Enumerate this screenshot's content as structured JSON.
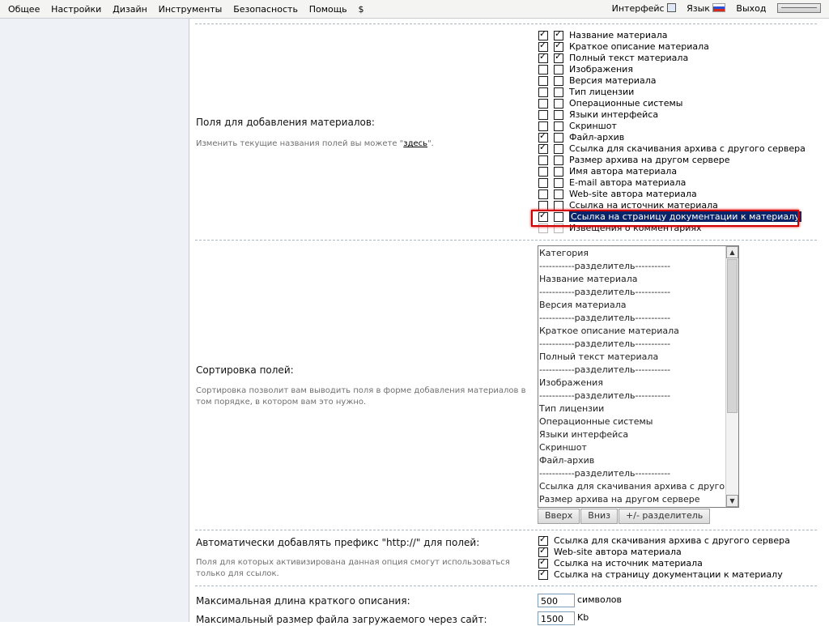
{
  "topbar": {
    "menu": [
      "Общее",
      "Настройки",
      "Дизайн",
      "Инструменты",
      "Безопасность",
      "Помощь",
      "$"
    ],
    "interface_label": "Интерфейс",
    "language_label": "Язык",
    "exit_label": "Выход"
  },
  "fields_section": {
    "label": "Поля для добавления материалов:",
    "desc_before": "Изменить текущие названия полей вы можете \"",
    "desc_link": "здесь",
    "desc_after": "\".",
    "items": [
      {
        "label": "Название материала",
        "c1": true,
        "c2": true
      },
      {
        "label": "Краткое описание материала",
        "c1": true,
        "c2": true
      },
      {
        "label": "Полный текст материала",
        "c1": true,
        "c2": true
      },
      {
        "label": "Изображения",
        "c1": false,
        "c2": false
      },
      {
        "label": "Версия материала",
        "c1": false,
        "c2": false
      },
      {
        "label": "Тип лицензии",
        "c1": false,
        "c2": false
      },
      {
        "label": "Операционные системы",
        "c1": false,
        "c2": false
      },
      {
        "label": "Языки интерфейса",
        "c1": false,
        "c2": false
      },
      {
        "label": "Скриншот",
        "c1": false,
        "c2": false
      },
      {
        "label": "Файл-архив",
        "c1": true,
        "c2": false
      },
      {
        "label": "Ссылка для скачивания архива с другого сервера",
        "c1": true,
        "c2": false
      },
      {
        "label": "Размер архива на другом сервере",
        "c1": false,
        "c2": false
      },
      {
        "label": "Имя автора материала",
        "c1": false,
        "c2": false
      },
      {
        "label": "E-mail автора материала",
        "c1": false,
        "c2": false
      },
      {
        "label": "Web-site автора материала",
        "c1": false,
        "c2": false
      },
      {
        "label": "Ссылка на источник материала",
        "c1": false,
        "c2": false
      },
      {
        "label": "Ссылка на страницу документации к материалу",
        "c1": true,
        "c2": false,
        "selected": true
      },
      {
        "label": "Извещения о комментариях",
        "c1": false,
        "c2": false,
        "disabled": true
      }
    ]
  },
  "sort_section": {
    "label": "Сортировка полей:",
    "desc": "Сортировка позволит вам выводить поля в форме добавления материалов в том порядке, в котором вам это нужно.",
    "items": [
      "Категория",
      "-----------разделитель-----------",
      "Название материала",
      "-----------разделитель-----------",
      "Версия материала",
      "-----------разделитель-----------",
      "Краткое описание материала",
      "-----------разделитель-----------",
      "Полный текст материала",
      "-----------разделитель-----------",
      "Изображения",
      "-----------разделитель-----------",
      "Тип лицензии",
      "Операционные системы",
      "Языки интерфейса",
      "Скриншот",
      "Файл-архив",
      "-----------разделитель-----------",
      "Ссылка для скачивания архива с другого сервера",
      "Размер архива на другом сервере"
    ],
    "btn_up": "Вверх",
    "btn_down": "Вниз",
    "btn_separator": "+/- разделитель"
  },
  "prefix_section": {
    "label": "Автоматически добавлять префикс \"http://\" для полей:",
    "desc": "Поля для которых активизирована данная опция смогут использоваться только для ссылок.",
    "items": [
      {
        "label": "Ссылка для скачивания архива с другого сервера",
        "checked": true
      },
      {
        "label": "Web-site автора материала",
        "checked": true
      },
      {
        "label": "Ссылка на источник материала",
        "checked": true
      },
      {
        "label": "Ссылка на страницу документации к материалу",
        "checked": true
      }
    ]
  },
  "maxlen": {
    "label": "Максимальная длина краткого описания:",
    "value": "500",
    "unit": "символов"
  },
  "maxsize": {
    "label": "Максимальный размер файла загружаемого через сайт:",
    "value": "1500",
    "unit": "Kb"
  }
}
